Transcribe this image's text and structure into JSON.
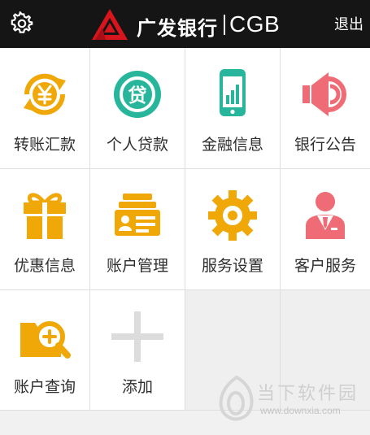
{
  "header": {
    "brand_cn": "广发银行",
    "brand_en": "CGB",
    "logout_label": "退出",
    "settings_icon": "gear-icon"
  },
  "grid": {
    "items": [
      {
        "label": "转账汇款",
        "icon": "transfer-icon",
        "color": "#f0a808"
      },
      {
        "label": "个人贷款",
        "icon": "loan-icon",
        "color": "#27b69b"
      },
      {
        "label": "金融信息",
        "icon": "phone-chart-icon",
        "color": "#27b69b"
      },
      {
        "label": "银行公告",
        "icon": "speaker-icon",
        "color": "#ef6b75"
      },
      {
        "label": "优惠信息",
        "icon": "gift-icon",
        "color": "#f0a808"
      },
      {
        "label": "账户管理",
        "icon": "account-cards-icon",
        "color": "#f0a808"
      },
      {
        "label": "服务设置",
        "icon": "settings-gear-icon",
        "color": "#f0a808"
      },
      {
        "label": "客户服务",
        "icon": "service-agent-icon",
        "color": "#ef6b75"
      },
      {
        "label": "账户查询",
        "icon": "folder-search-icon",
        "color": "#f0a808"
      },
      {
        "label": "添加",
        "icon": "plus-icon",
        "color": "#dcdcdc"
      }
    ]
  },
  "watermark": {
    "text": "当下软件园",
    "url": "www.downxia.com"
  }
}
